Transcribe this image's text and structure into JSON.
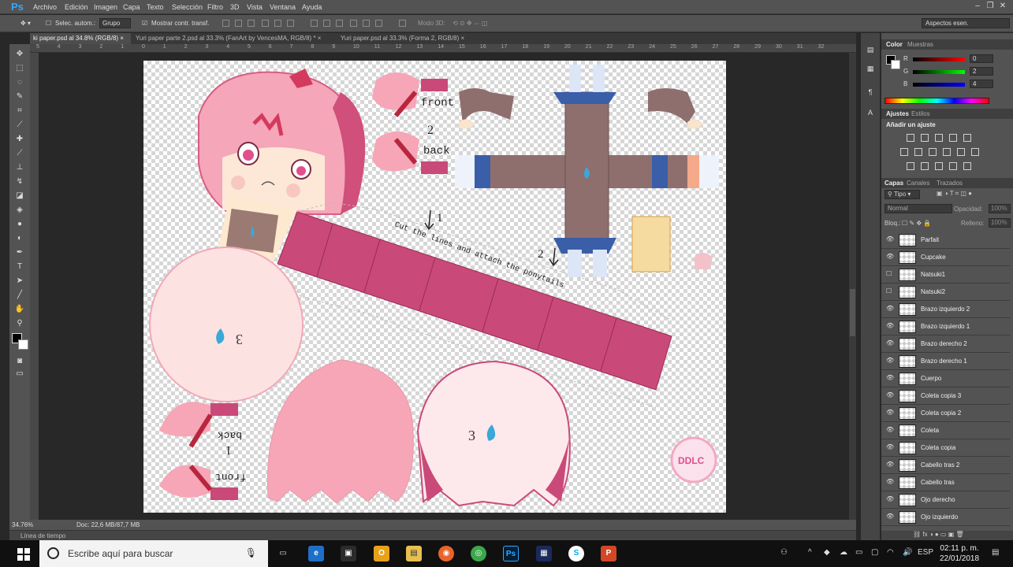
{
  "app": {
    "logo": "Ps"
  },
  "menu": [
    "Archivo",
    "Edición",
    "Imagen",
    "Capa",
    "Texto",
    "Selección",
    "Filtro",
    "3D",
    "Vista",
    "Ventana",
    "Ayuda"
  ],
  "options": {
    "auto_select": "Selec. autom.:",
    "group": "Grupo",
    "show_transform": "Mostrar contr. transf.",
    "mode3d": "Modo 3D:",
    "workspace": "Aspectos esen."
  },
  "tabs": [
    {
      "label": "ki paper.psd al 34.8% (RGB/8)"
    },
    {
      "label": "Yuri paper parte 2.psd al 33.3% (FanArt by  VencesMA, RGB/8) *"
    },
    {
      "label": "Yuri paper.psd al 33.3% (Forma 2, RGB/8)"
    }
  ],
  "ruler_ticks": [
    "5",
    "4",
    "3",
    "2",
    "1",
    "0",
    "1",
    "2",
    "3",
    "4",
    "5",
    "6",
    "7",
    "8",
    "9",
    "10",
    "11",
    "12",
    "13",
    "14",
    "15",
    "16",
    "17",
    "18",
    "19",
    "20",
    "21",
    "22",
    "23",
    "24",
    "25",
    "26",
    "27",
    "28",
    "29",
    "30",
    "31",
    "32"
  ],
  "status": {
    "zoom": "34.76%",
    "doc": "Doc: 22,6 MB/87,7 MB"
  },
  "timeline": "Línea de tiempo",
  "color_panel": {
    "tabs": [
      "Color",
      "Muestras"
    ],
    "r": "0",
    "g": "2",
    "b": "4",
    "r_label": "R",
    "g_label": "G",
    "b_label": "B"
  },
  "adjust_panel": {
    "tabs": [
      "Ajustes",
      "Estilos"
    ],
    "title": "Añadir un ajuste"
  },
  "layers_panel": {
    "tabs": [
      "Capas",
      "Canales",
      "Trazados"
    ],
    "kind": "Tipo",
    "blend": "Normal",
    "opacity_label": "Opacidad:",
    "opacity": "100%",
    "lock_label": "Bloq.:",
    "fill_label": "Relleno:",
    "fill": "100%"
  },
  "layers": [
    "Parfait",
    "Cupcake",
    "Natsuki1",
    "Natsuki2",
    "Brazo izquierdo 2",
    "Brazo izquierdo 1",
    "Brazo derecho 2",
    "Brazo derecho 1",
    "Cuerpo",
    "Coleta copia 3",
    "Coleta copia 2",
    "Coleta",
    "Coleta copia",
    "Cabello tras 2",
    "Cabello tras",
    "Ojo derecho",
    "Ojo izquierdo"
  ],
  "canvas_text": {
    "front": "front",
    "two": "2",
    "back": "back",
    "instruction": "Cut the lines and attach the ponytails",
    "arrow1": "1",
    "arrow2": "2",
    "three_a": "3",
    "three_b": "3",
    "back_b": "back",
    "one": "1",
    "front_b": "front"
  },
  "taskbar": {
    "search": "Escribe aquí para buscar",
    "lang": "ESP",
    "time": "02:11 p. m.",
    "date": "22/01/2018"
  },
  "colors": {
    "pink": "#d4557f",
    "hair": "#f5a0b5",
    "skin": "#fde4e4"
  }
}
